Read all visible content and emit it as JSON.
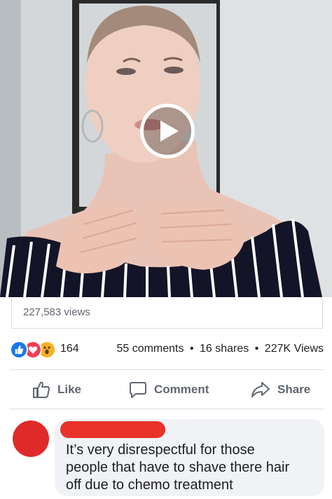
{
  "video": {
    "play_icon": "play-icon",
    "views": "227,583 views"
  },
  "reactions": {
    "icons": [
      "like-reaction-icon",
      "love-reaction-icon",
      "wow-reaction-icon"
    ],
    "count": "164",
    "comments": "55 comments",
    "shares": "16 shares",
    "views": "227K Views",
    "separator": "•"
  },
  "actions": {
    "like_label": "Like",
    "comment_label": "Comment",
    "share_label": "Share"
  },
  "comment": {
    "text": "It’s very disrespectful for those people that have to shave there hair off due to chemo treatment"
  },
  "colors": {
    "like_blue": "#1877f2",
    "love_red": "#f33e58",
    "wow_yellow": "#f7b125",
    "redaction": "#e8322a"
  }
}
